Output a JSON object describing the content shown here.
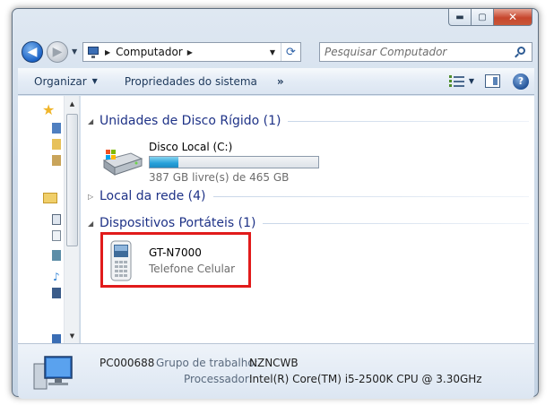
{
  "window": {
    "caption": {
      "minimize": "▬",
      "maximize": "▢",
      "close": "✕"
    }
  },
  "navbar": {
    "back": "◀",
    "forward": "▶",
    "address_location": "Computador",
    "search_placeholder": "Pesquisar Computador"
  },
  "toolbar": {
    "organize_label": "Organizar",
    "system_properties_label": "Propriedades do sistema",
    "more_label": "»"
  },
  "groups": {
    "hard_disks": {
      "title": "Unidades de Disco Rígido (1)",
      "expanded": true
    },
    "network": {
      "title": "Local da rede (4)",
      "expanded": false
    },
    "portable": {
      "title": "Dispositivos Portáteis (1)",
      "expanded": true
    }
  },
  "drive": {
    "name": "Disco Local (C:)",
    "free_text": "387 GB livre(s) de 465 GB",
    "used_fraction": 0.168,
    "bar_color": "#26a0da"
  },
  "device": {
    "name": "GT-N7000",
    "type": "Telefone Celular",
    "highlight_color": "#e11b1b"
  },
  "details": {
    "computer_name": "PC000688",
    "workgroup_label": "Grupo de trabalho:",
    "workgroup_value": "NZNCWB",
    "processor_label": "Processador:",
    "processor_value": "Intel(R) Core(TM) i5-2500K CPU @ 3.30GHz"
  },
  "icons": [
    "star-icon",
    "computer-icon",
    "drive-icon",
    "phone-icon",
    "search-icon",
    "help-icon",
    "refresh-icon"
  ]
}
